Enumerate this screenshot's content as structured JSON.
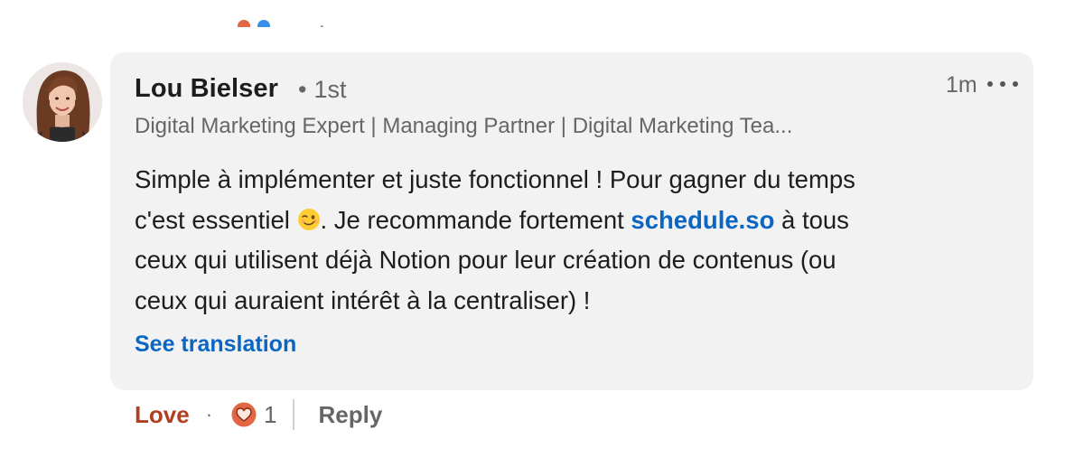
{
  "comment": {
    "author": {
      "name": "Lou Bielser",
      "connection_degree": "1st",
      "headline": "Digital Marketing Expert | Managing Partner | Digital Marketing Tea..."
    },
    "timestamp": "1m",
    "text": {
      "line1": "Simple à implémenter et juste fonctionnel ! Pour gagner du temps",
      "line2_part1": "c'est essentiel ",
      "emoji": "winking-face",
      "line2_part2": ". Je recommande fortement ",
      "link": "schedule.so",
      "line2_part3": " à tous",
      "line3": "ceux qui utilisent déjà Notion pour leur création de contenus (ou",
      "line4": "ceux qui auraient intérêt à la centraliser) !"
    },
    "see_translation_label": "See translation",
    "actions": {
      "reaction_label": "Love",
      "separator": "·",
      "reaction_icon": "heart-icon",
      "reaction_count": "1",
      "reply_label": "Reply"
    }
  },
  "colors": {
    "link": "#0a66c2",
    "love": "#b24020",
    "bubble_background": "#f2f2f2",
    "heart_badge": "#e16745"
  }
}
